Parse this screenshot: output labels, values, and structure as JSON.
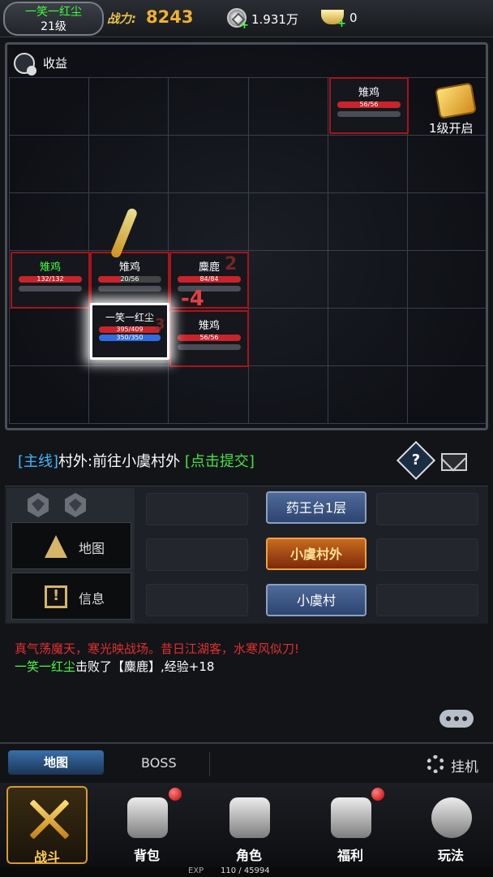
{
  "player": {
    "name": "一笑一红尘",
    "level": "21级"
  },
  "power": {
    "label": "战力:",
    "value": "8243"
  },
  "currency": {
    "coin": "1.931万",
    "ingot": "0"
  },
  "map": {
    "title": "收益",
    "chest_label": "1级开启",
    "monsters": [
      {
        "name": "雉鸡",
        "hp": "56/56",
        "hp_fraction": 1.0
      },
      {
        "name": "雉鸡",
        "hp": "132/132",
        "hp_fraction": 1.0
      },
      {
        "name": "雉鸡",
        "hp": "20/56",
        "hp_fraction": 0.36
      },
      {
        "name": "麋鹿",
        "hp": "84/84",
        "hp_fraction": 1.0
      },
      {
        "name": "雉鸡",
        "hp": "56/56",
        "hp_fraction": 1.0
      }
    ],
    "hero": {
      "name": "一笑一红尘",
      "hp": "395/409",
      "mp": "350/350",
      "hp_fraction": 0.97,
      "mp_fraction": 1.0
    },
    "damage_main": "-4",
    "damage_faded_a": "2",
    "damage_faded_b": "3"
  },
  "quest": {
    "tag": "[主线]",
    "text": "村外:前往小虞村外",
    "submit": "[点击提交]"
  },
  "side_buttons": {
    "map": "地图",
    "info": "信息"
  },
  "locations": {
    "upper": "药王台1层",
    "current": "小虞村外",
    "lower": "小虞村"
  },
  "log": {
    "line1": "真气荡魔天，寒光映战场。昔日江湖客，水寒风似刀!",
    "line2_who": "一笑一红尘",
    "line2_rest": "击败了【麋鹿】,经验+18"
  },
  "subtabs": {
    "map": "地图",
    "boss": "BOSS",
    "hangup": "挂机"
  },
  "nav": [
    {
      "label": "战斗"
    },
    {
      "label": "背包"
    },
    {
      "label": "角色"
    },
    {
      "label": "福利"
    },
    {
      "label": "玩法"
    }
  ],
  "exp": {
    "label": "EXP",
    "value": "110 / 45994"
  },
  "colors": {
    "accent_gold": "#f0b030",
    "hp_red": "#c8242a",
    "mp_blue": "#2f6de0",
    "name_green": "#3cff3c",
    "quest_blue": "#3fb8ff"
  }
}
